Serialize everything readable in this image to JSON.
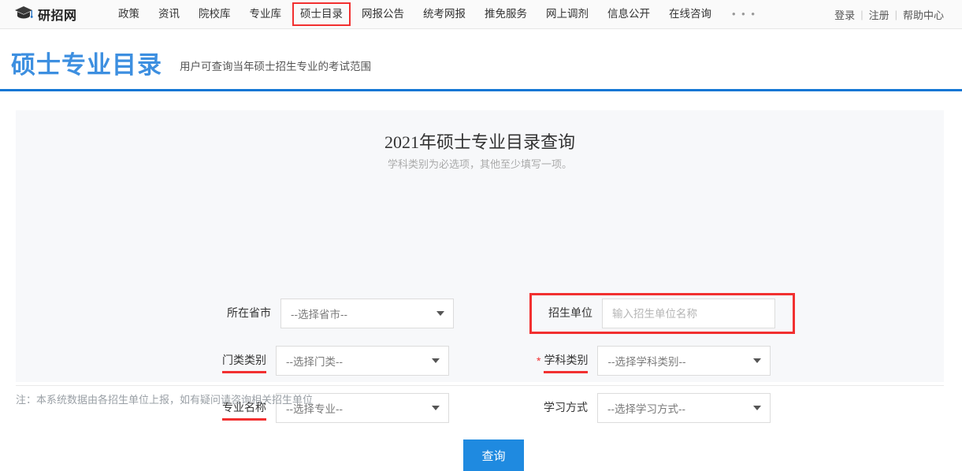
{
  "nav": {
    "brand": "研招网",
    "brand_icon": "graduation-cap-icon",
    "items": [
      {
        "label": "政策",
        "highlight": false
      },
      {
        "label": "资讯",
        "highlight": false
      },
      {
        "label": "院校库",
        "highlight": false
      },
      {
        "label": "专业库",
        "highlight": false
      },
      {
        "label": "硕士目录",
        "highlight": true
      },
      {
        "label": "网报公告",
        "highlight": false
      },
      {
        "label": "统考网报",
        "highlight": false
      },
      {
        "label": "推免服务",
        "highlight": false
      },
      {
        "label": "网上调剂",
        "highlight": false
      },
      {
        "label": "信息公开",
        "highlight": false
      },
      {
        "label": "在线咨询",
        "highlight": false
      }
    ],
    "more": "• • •",
    "login": "登录",
    "register": "注册",
    "help": "帮助中心",
    "separator": "|"
  },
  "header": {
    "title": "硕士专业目录",
    "subtitle": "用户可查询当年硕士招生专业的考试范围"
  },
  "form": {
    "title": "2021年硕士专业目录查询",
    "note": "学科类别为必选项，其他至少填写一项。",
    "fields": {
      "province": {
        "label": "所在省市",
        "value": "--选择省市--"
      },
      "unit": {
        "label": "招生单位",
        "value": "",
        "placeholder": "输入招生单位名称"
      },
      "category": {
        "label": "门类类别",
        "value": "--选择门类--"
      },
      "subject": {
        "label": "学科类别",
        "value": "--选择学科类别--",
        "required_mark": "*"
      },
      "major": {
        "label": "专业名称",
        "value": "--选择专业--"
      },
      "study": {
        "label": "学习方式",
        "value": "--选择学习方式--"
      }
    },
    "submit_label": "查询"
  },
  "footer": {
    "note": "注：本系统数据由各招生单位上报，如有疑问请咨询相关招生单位"
  },
  "colors": {
    "accent_blue": "#1277d5",
    "title_blue": "#3d8fe0",
    "button_blue": "#1f8ae0",
    "highlight_red": "#f23030",
    "panel_bg": "#f7f8fa"
  }
}
